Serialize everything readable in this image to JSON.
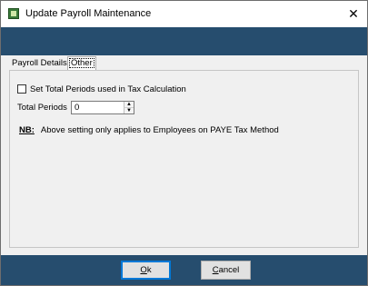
{
  "window": {
    "title": "Update Payroll Maintenance",
    "close_glyph": "✕",
    "icon": "payroll-app-icon"
  },
  "tabs": [
    {
      "label": "Payroll Details",
      "active": false
    },
    {
      "label": "Other",
      "active": true
    }
  ],
  "other_tab": {
    "set_periods_checkbox": {
      "label": "Set Total Periods used in Tax Calculation",
      "checked": false
    },
    "total_periods": {
      "label": "Total Periods",
      "value": "0"
    },
    "note": {
      "label": "NB:",
      "text": "Above setting only applies to Employees on PAYE Tax Method"
    }
  },
  "buttons": {
    "ok": {
      "accel": "O",
      "rest": "k"
    },
    "cancel": {
      "accel": "C",
      "rest": "ancel"
    }
  },
  "colors": {
    "band": "#264d6e",
    "panel": "#f0f0f0",
    "focus": "#0078d7"
  }
}
